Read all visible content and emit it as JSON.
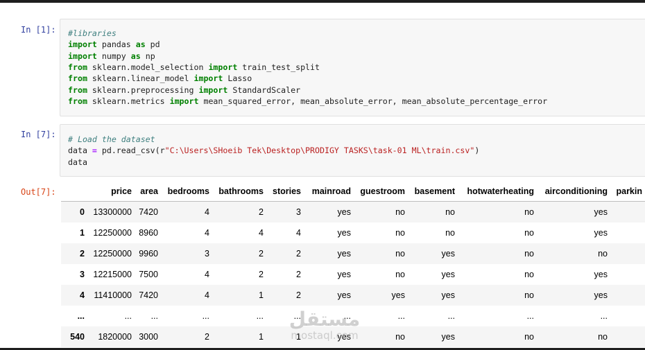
{
  "cells": [
    {
      "prompt": "In [1]:",
      "lines": [
        [
          {
            "t": "#libraries",
            "c": "cm-comment"
          }
        ],
        [
          {
            "t": "import",
            "c": "cm-keyword"
          },
          {
            "t": " pandas "
          },
          {
            "t": "as",
            "c": "cm-keyword"
          },
          {
            "t": " pd"
          }
        ],
        [
          {
            "t": "import",
            "c": "cm-keyword"
          },
          {
            "t": " numpy "
          },
          {
            "t": "as",
            "c": "cm-keyword"
          },
          {
            "t": " np"
          }
        ],
        [
          {
            "t": "from",
            "c": "cm-keyword"
          },
          {
            "t": " sklearn.model_selection "
          },
          {
            "t": "import",
            "c": "cm-keyword"
          },
          {
            "t": " train_test_split"
          }
        ],
        [
          {
            "t": "from",
            "c": "cm-keyword"
          },
          {
            "t": " sklearn.linear_model "
          },
          {
            "t": "import",
            "c": "cm-keyword"
          },
          {
            "t": " Lasso"
          }
        ],
        [
          {
            "t": "from",
            "c": "cm-keyword"
          },
          {
            "t": " sklearn.preprocessing "
          },
          {
            "t": "import",
            "c": "cm-keyword"
          },
          {
            "t": " StandardScaler"
          }
        ],
        [
          {
            "t": "from",
            "c": "cm-keyword"
          },
          {
            "t": " sklearn.metrics "
          },
          {
            "t": "import",
            "c": "cm-keyword"
          },
          {
            "t": " mean_squared_error, mean_absolute_error, mean_absolute_percentage_error"
          }
        ]
      ]
    },
    {
      "prompt": "In [7]:",
      "lines": [
        [
          {
            "t": "# Load the dataset",
            "c": "cm-comment"
          }
        ],
        [
          {
            "t": "data "
          },
          {
            "t": "=",
            "c": "cm-op"
          },
          {
            "t": " pd.read_csv(r"
          },
          {
            "t": "\"C:\\Users\\SHoeib Tek\\Desktop\\PRODIGY TASKS\\task-01 ML\\train.csv\"",
            "c": "cm-string"
          },
          {
            "t": ")"
          }
        ],
        [
          {
            "t": "data"
          }
        ]
      ]
    }
  ],
  "output": {
    "prompt": "Out[7]:",
    "columns": [
      "",
      "price",
      "area",
      "bedrooms",
      "bathrooms",
      "stories",
      "mainroad",
      "guestroom",
      "basement",
      "hotwaterheating",
      "airconditioning",
      "parkin"
    ],
    "rows": [
      [
        "0",
        "13300000",
        "7420",
        "4",
        "2",
        "3",
        "yes",
        "no",
        "no",
        "no",
        "yes",
        ""
      ],
      [
        "1",
        "12250000",
        "8960",
        "4",
        "4",
        "4",
        "yes",
        "no",
        "no",
        "no",
        "yes",
        ""
      ],
      [
        "2",
        "12250000",
        "9960",
        "3",
        "2",
        "2",
        "yes",
        "no",
        "yes",
        "no",
        "no",
        ""
      ],
      [
        "3",
        "12215000",
        "7500",
        "4",
        "2",
        "2",
        "yes",
        "no",
        "yes",
        "no",
        "yes",
        ""
      ],
      [
        "4",
        "11410000",
        "7420",
        "4",
        "1",
        "2",
        "yes",
        "yes",
        "yes",
        "no",
        "yes",
        ""
      ],
      [
        "...",
        "...",
        "...",
        "...",
        "...",
        "...",
        "...",
        "...",
        "...",
        "...",
        "...",
        ""
      ],
      [
        "540",
        "1820000",
        "3000",
        "2",
        "1",
        "1",
        "yes",
        "no",
        "yes",
        "no",
        "no",
        ""
      ]
    ]
  },
  "watermark": {
    "arabic": "مستقل",
    "latin": "mostaql.com"
  }
}
